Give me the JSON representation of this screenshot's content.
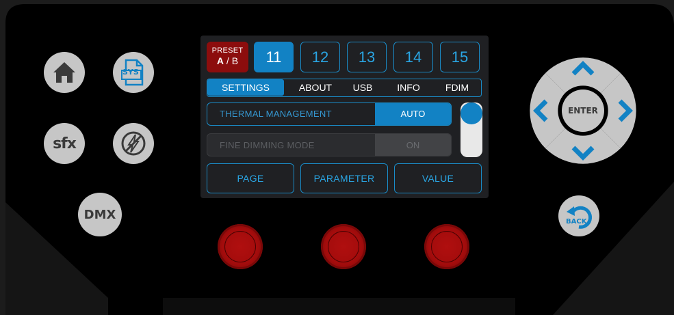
{
  "left_buttons": {
    "home_icon": "home-icon",
    "sys_label": "SYS",
    "sfx_label": "sfx",
    "blackout_icon": "no-lightning-icon",
    "dmx_label": "DMX"
  },
  "screen": {
    "preset": {
      "line1": "PRESET",
      "a": "A",
      "sep": " / ",
      "b": "B"
    },
    "presets": [
      {
        "label": "11",
        "selected": true
      },
      {
        "label": "12",
        "selected": false
      },
      {
        "label": "13",
        "selected": false
      },
      {
        "label": "14",
        "selected": false
      },
      {
        "label": "15",
        "selected": false
      }
    ],
    "tabs": [
      "SETTINGS",
      "ABOUT",
      "USB",
      "INFO",
      "FDIM"
    ],
    "active_tab": "SETTINGS",
    "rows": [
      {
        "name": "THERMAL MANAGEMENT",
        "value": "AUTO",
        "enabled": true
      },
      {
        "name": "FINE DIMMING MODE",
        "value": "ON",
        "enabled": false
      }
    ],
    "footer": [
      "PAGE",
      "PARAMETER",
      "VALUE"
    ]
  },
  "right_buttons": {
    "enter_label": "ENTER",
    "back_label": "BACK"
  },
  "colors": {
    "accent": "#1282c4",
    "preset_red": "#8c0d0d",
    "button_gray": "#c6c6c6",
    "knob_red": "#a40c0c"
  }
}
